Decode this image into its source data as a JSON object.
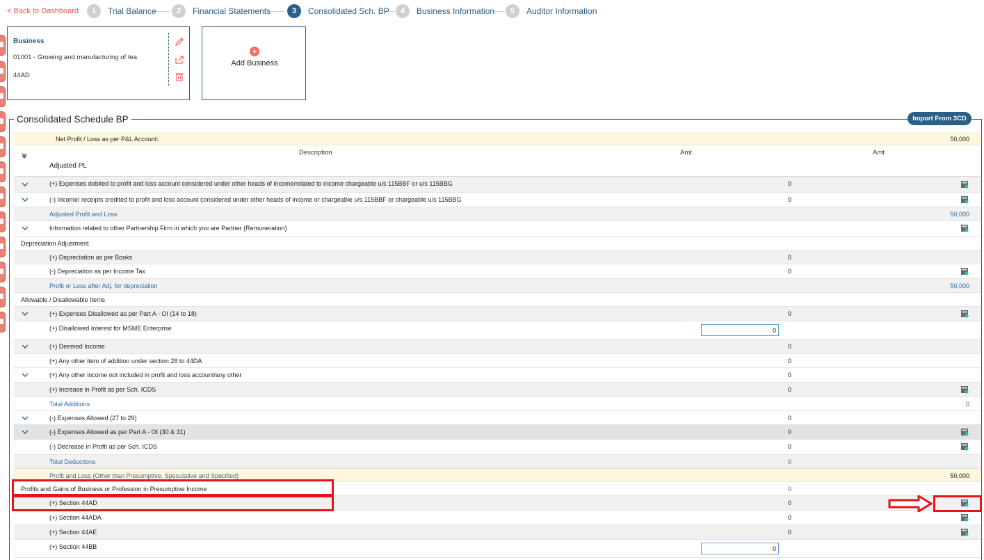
{
  "nav": {
    "back": "< Back to Dashboard",
    "steps": [
      {
        "num": "1",
        "label": "Trial Balance"
      },
      {
        "num": "2",
        "label": "Financial Statements"
      },
      {
        "num": "3",
        "label": "Consolidated Sch. BP"
      },
      {
        "num": "4",
        "label": "Business Information"
      },
      {
        "num": "5",
        "label": "Auditor Information"
      }
    ],
    "active_step": "3"
  },
  "business_card": {
    "title": "Business",
    "line1": "01001 - Growing and manufacturing of tea",
    "line2": "44AD",
    "actions": [
      "edit-icon",
      "export-icon",
      "delete-icon"
    ]
  },
  "add_business": {
    "label": "Add Business",
    "icon": "plus-circle-icon"
  },
  "schedule": {
    "title": "Consolidated Schedule BP",
    "import_button": "Import From 3CD",
    "net_profit": {
      "label": "Net Profit / Loss as per P&L Account:",
      "value": "50,000"
    },
    "headers": {
      "description": "Description",
      "amt1": "Amt",
      "amt2": "Amt"
    },
    "adjusted_pl": "Adjusted PL",
    "rows": [
      {
        "desc": "(+) Expenses debited to profit and loss account considered under other heads of income/related to income chargeable u/s 115BBF or u/s 115BBG",
        "amt1": "0",
        "amt2": ""
      },
      {
        "desc": "(-) Income/ receipts credited to profit and loss account considered under other heads of income or chargeable u/s 115BBF or chargeable u/s 115BBG",
        "amt1": "0",
        "amt2": ""
      },
      {
        "desc": "Adjusted Profit and Loss",
        "amt1": "",
        "amt2": "50,000"
      },
      {
        "desc": "Information related to other Partnership Firm in which you are Partner (Remuneration)",
        "amt1": "",
        "amt2": ""
      },
      {
        "desc": "Depreciation Adjustment",
        "amt1": "",
        "amt2": ""
      },
      {
        "desc": "(+) Depreciation as per Books",
        "amt1": "0",
        "amt2": ""
      },
      {
        "desc": "(-) Depreciation as per Income Tax",
        "amt1": "0",
        "amt2": ""
      },
      {
        "desc": "Profit or Loss after Adj. for depreciation",
        "amt1": "",
        "amt2": "50,000"
      },
      {
        "desc": "Allowable / Disallowable Items",
        "amt1": "",
        "amt2": ""
      },
      {
        "desc": "(+) Expenses Disallowed as per Part A - OI (14 to 18)",
        "amt1": "0",
        "amt2": ""
      },
      {
        "desc": "(+) Disallowed Interest for MSME Enterprise",
        "amt1": "0",
        "amt2": ""
      },
      {
        "desc": "(+) Deemed Income",
        "amt1": "0",
        "amt2": ""
      },
      {
        "desc": "(+) Any other item of addition under section 28 to 44DA",
        "amt1": "0",
        "amt2": ""
      },
      {
        "desc": "(+) Any other income not included in profit and loss account/any other",
        "amt1": "0",
        "amt2": ""
      },
      {
        "desc": "(+) Increase in Profit as per Sch. ICDS",
        "amt1": "0",
        "amt2": ""
      },
      {
        "desc": "Total Additions",
        "amt1": "",
        "amt2": "0"
      },
      {
        "desc": "(-) Expenses Allowed (27 to 29)",
        "amt1": "0",
        "amt2": ""
      },
      {
        "desc": "(-) Expenses Allowed as per Part A - OI (30 & 31)",
        "amt1": "0",
        "amt2": ""
      },
      {
        "desc": "(-) Decrease in Profit as per Sch. ICDS",
        "amt1": "0",
        "amt2": ""
      },
      {
        "desc": "Total Deductions",
        "amt1": "0",
        "amt2": ""
      },
      {
        "desc": "Profit and Loss (Other than Presumptive, Speculative and Specified)",
        "amt1": "",
        "amt2": "50,000"
      },
      {
        "desc": "Profits and Gains of Business or Profession in Presumptive Income",
        "amt1": "0",
        "amt2": ""
      },
      {
        "desc": "(+) Section 44AD",
        "amt1": "0",
        "amt2": ""
      },
      {
        "desc": "(+) Section 44ADA",
        "amt1": "0",
        "amt2": ""
      },
      {
        "desc": "(+) Section 44AE",
        "amt1": "0",
        "amt2": ""
      },
      {
        "desc": "(+) Section 44BB",
        "amt1": "0",
        "amt2": ""
      }
    ]
  },
  "colors": {
    "brand": "#2a6088",
    "accent": "#f26b5b",
    "highlight": "#e3141a",
    "link_blue": "#2a6aa5"
  }
}
